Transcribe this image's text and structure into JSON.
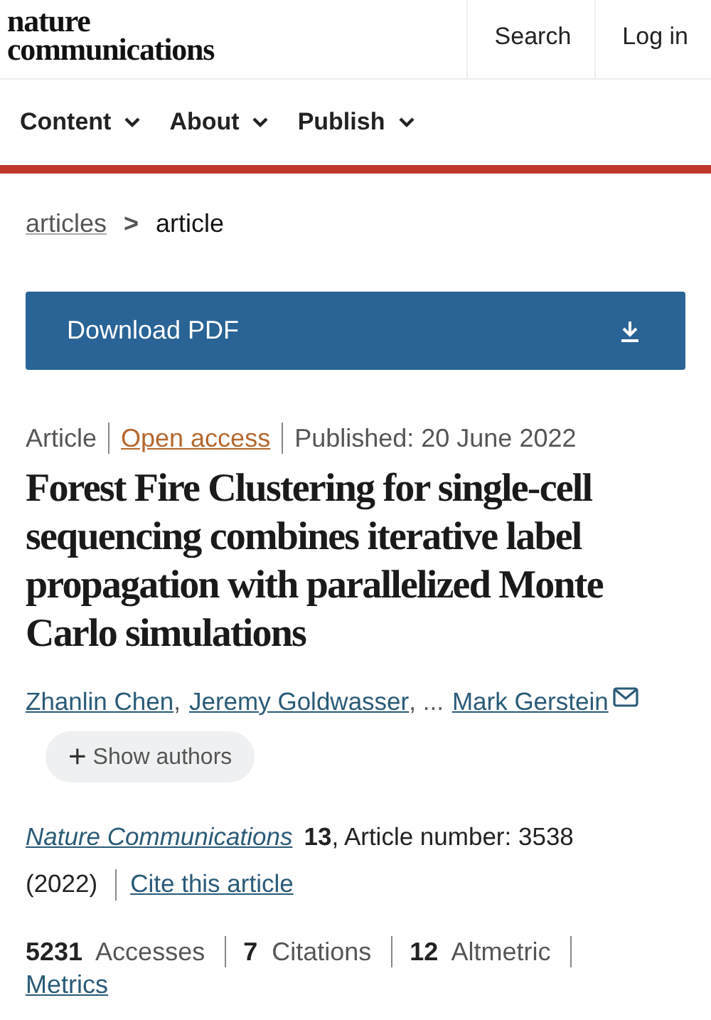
{
  "header": {
    "logo": [
      "nature",
      "communications"
    ],
    "actions": [
      "Search",
      "Log in"
    ]
  },
  "nav": [
    {
      "label": "Content"
    },
    {
      "label": "About"
    },
    {
      "label": "Publish"
    }
  ],
  "breadcrumb": {
    "parent": "articles",
    "separator": ">",
    "current": "article"
  },
  "download_button": {
    "label": "Download PDF"
  },
  "meta": {
    "type": "Article",
    "access": "Open access",
    "published": "Published: 20 June 2022"
  },
  "title": "Forest Fire Clustering for single-cell sequencing combines iterative label propagation with parallelized Monte Carlo simulations",
  "authors": [
    {
      "name": "Zhanlin Chen",
      "after": ",",
      "corresponding": false
    },
    {
      "name": "Jeremy Goldwasser",
      "after": ", ...",
      "corresponding": false
    },
    {
      "name": "Mark Gerstein",
      "corresponding": true
    }
  ],
  "show_authors": {
    "icon": "+",
    "label": "Show authors"
  },
  "citation": {
    "journal": "Nature Communications",
    "details": "**13**, Article number: 3538",
    "year": "(2022)",
    "cite_link": "Cite this article"
  },
  "metrics": [
    "**5231**  Accesses",
    "**7**  Citations",
    "**12**  Altmetric"
  ],
  "metrics_link": "Metrics"
}
